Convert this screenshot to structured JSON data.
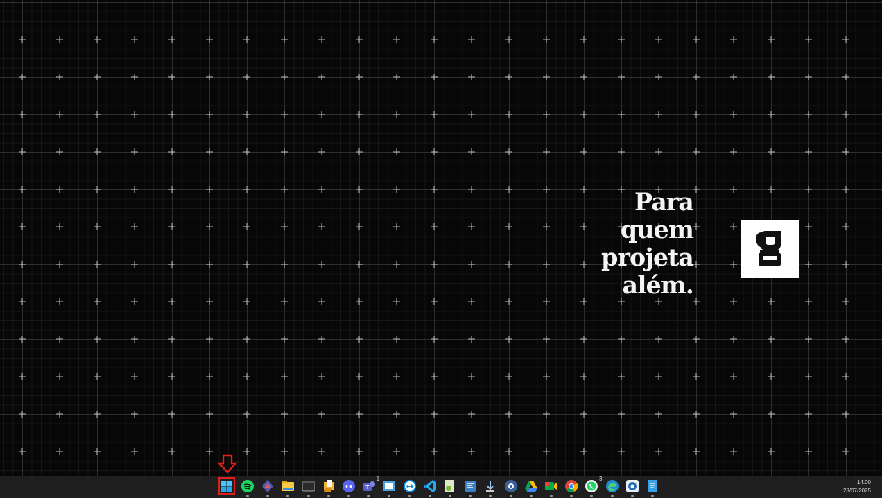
{
  "wallpaper": {
    "tagline_lines": [
      "Para",
      "quem",
      "projeta",
      "além."
    ],
    "logo_letter": "g"
  },
  "taskbar": {
    "start_label": "Start",
    "apps": [
      {
        "name": "spotify-icon"
      },
      {
        "name": "vpn-icon"
      },
      {
        "name": "file-explorer-icon"
      },
      {
        "name": "terminal-icon"
      },
      {
        "name": "file-manager-icon"
      },
      {
        "name": "discord-icon"
      },
      {
        "name": "teams-icon",
        "badge": "1"
      },
      {
        "name": "screen-tool-icon"
      },
      {
        "name": "teamviewer-icon"
      },
      {
        "name": "vscode-icon"
      },
      {
        "name": "notepad-plus-icon"
      },
      {
        "name": "text-editor-icon"
      },
      {
        "name": "download-icon"
      },
      {
        "name": "settings-app-icon"
      },
      {
        "name": "google-drive-icon"
      },
      {
        "name": "google-meet-icon"
      },
      {
        "name": "chrome-icon"
      },
      {
        "name": "whatsapp-icon",
        "badge": "3"
      },
      {
        "name": "edge-icon"
      },
      {
        "name": "app-icon"
      },
      {
        "name": "notes-icon"
      }
    ],
    "clock": {
      "time": "14:00",
      "date": "28/07/2025"
    }
  },
  "colors": {
    "highlight": "#e0201b",
    "taskbar": "#1f1f1f"
  }
}
